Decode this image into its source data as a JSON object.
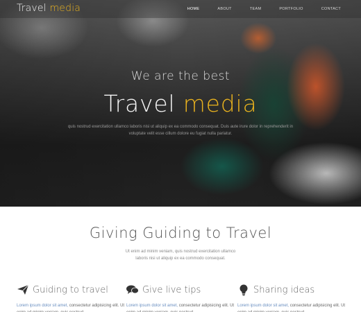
{
  "header": {
    "logo_main": "Travel ",
    "logo_accent": "media",
    "nav": [
      "HOME",
      "ABOUT",
      "TEAM",
      "PORTFOLIO",
      "CONTACT"
    ]
  },
  "hero": {
    "tagline": "We are the best",
    "title_main": "Travel ",
    "title_accent": "media",
    "description": "quis nostrud exercitation ullamco laboris nisi ut aliquip ex ea commodo consequat. Duis aute irure dolor in reprehenderit in voluptate velit esse cillum dolore eu fugiat nulla pariatur."
  },
  "section": {
    "title": "Giving Guiding to Travel",
    "description": "Ut enim ad minim veniam, quis nostrud exercitation ullamco laboris nisi ut aliquip ex ea commodo consequat."
  },
  "features": [
    {
      "title": "Guiding to travel",
      "icon": "paper-plane-icon",
      "lead": "Lorem ipsum dolor sit amet,",
      "text": " consectetur adipisicing elit. Ut enim ad minim veniam, quis nostrud"
    },
    {
      "title": "Give live tips",
      "icon": "chat-bubbles-icon",
      "lead": "Lorem ipsum dolor sit amet,",
      "text": " consectetur adipisicing elit. Ut enim ad minim veniam, quis nostrud"
    },
    {
      "title": "Sharing ideas",
      "icon": "lightbulb-icon",
      "lead": "Lorem ipsum dolor sit amet,",
      "text": " consectetur adipisicing elit. Ut enim ad minim veniam, quis nostrud"
    }
  ],
  "colors": {
    "accent": "#e9b21e",
    "text_muted": "#666666"
  }
}
